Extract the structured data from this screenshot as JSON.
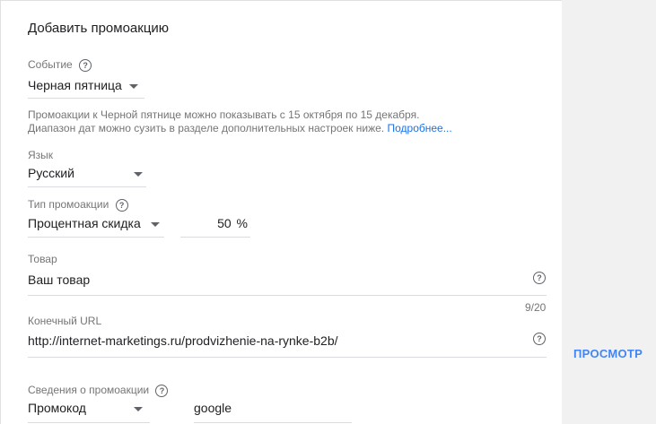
{
  "form": {
    "title": "Добавить промоакцию",
    "event": {
      "label": "Событие",
      "value": "Черная пятница",
      "hint_line1": "Промоакции к Черной пятнице можно показывать с 15 октября по 15 декабря.",
      "hint_line2": "Диапазон дат можно сузить в разделе дополнительных настроек ниже.",
      "hint_link": "Подробнее..."
    },
    "language": {
      "label": "Язык",
      "value": "Русский"
    },
    "promo_type": {
      "label": "Тип промоакции",
      "value": "Процентная скидка",
      "percent_value": "50",
      "percent_unit": "%"
    },
    "product": {
      "label": "Товар",
      "value": "Ваш товар",
      "counter": "9/20"
    },
    "final_url": {
      "label": "Конечный URL",
      "value": "http://internet-marketings.ru/prodvizhenie-na-rynke-b2b/"
    },
    "promo_details": {
      "label": "Сведения о промоакции",
      "value": "Промокод",
      "code_value": "google"
    }
  },
  "side": {
    "preview_label": "ПРОСМОТР"
  },
  "icons": {
    "help": "help-circle-icon",
    "dropdown": "dropdown-caret-icon"
  }
}
